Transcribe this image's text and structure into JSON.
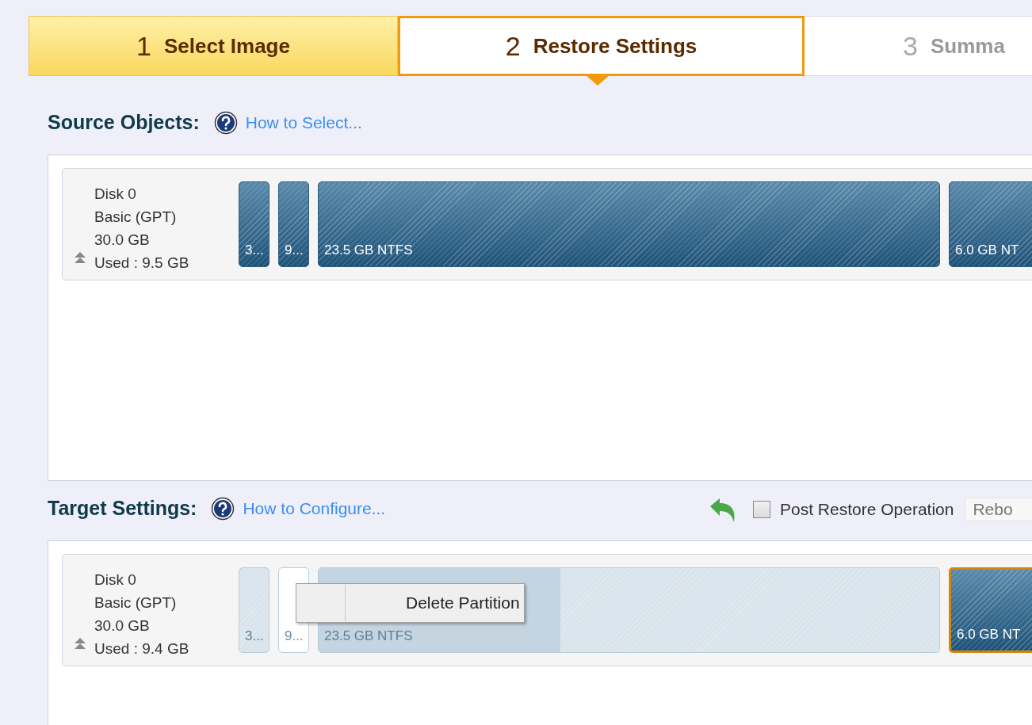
{
  "steps": [
    {
      "number": "1",
      "label": "Select Image",
      "completed": true,
      "selected": false
    },
    {
      "number": "2",
      "label": "Restore Settings",
      "completed": false,
      "selected": true
    },
    {
      "number": "3",
      "label": "Summa",
      "completed": false,
      "selected": false
    }
  ],
  "source": {
    "heading": "Source Objects:",
    "help_link": "How to Select...",
    "disk": {
      "name": "Disk 0",
      "type": "Basic (GPT)",
      "size": "30.0 GB",
      "used": "Used : 9.5 GB",
      "partitions": [
        {
          "label": "3...",
          "kind": "normal",
          "selected": false
        },
        {
          "label": "9...",
          "kind": "normal",
          "selected": false
        },
        {
          "label": "23.5 GB NTFS",
          "kind": "normal",
          "selected": false
        },
        {
          "label": "6.0 GB NT",
          "kind": "normal",
          "selected": false
        }
      ]
    }
  },
  "target": {
    "heading": "Target Settings:",
    "help_link": "How to Configure...",
    "post_restore": {
      "label": "Post Restore Operation",
      "checked": false,
      "dropdown": "Rebo"
    },
    "disk": {
      "name": "Disk 0",
      "type": "Basic (GPT)",
      "size": "30.0 GB",
      "used": "Used : 9.4 GB",
      "partitions": [
        {
          "label": "3...",
          "kind": "faded",
          "selected": false
        },
        {
          "label": "9...",
          "kind": "free",
          "selected": false
        },
        {
          "label": "23.5 GB NTFS",
          "kind": "faded",
          "selected": false,
          "level": 0.39
        },
        {
          "label": "6.0 GB NT",
          "kind": "normal",
          "selected": true
        }
      ]
    }
  },
  "context_menu": {
    "items": [
      "Delete Partition"
    ]
  }
}
